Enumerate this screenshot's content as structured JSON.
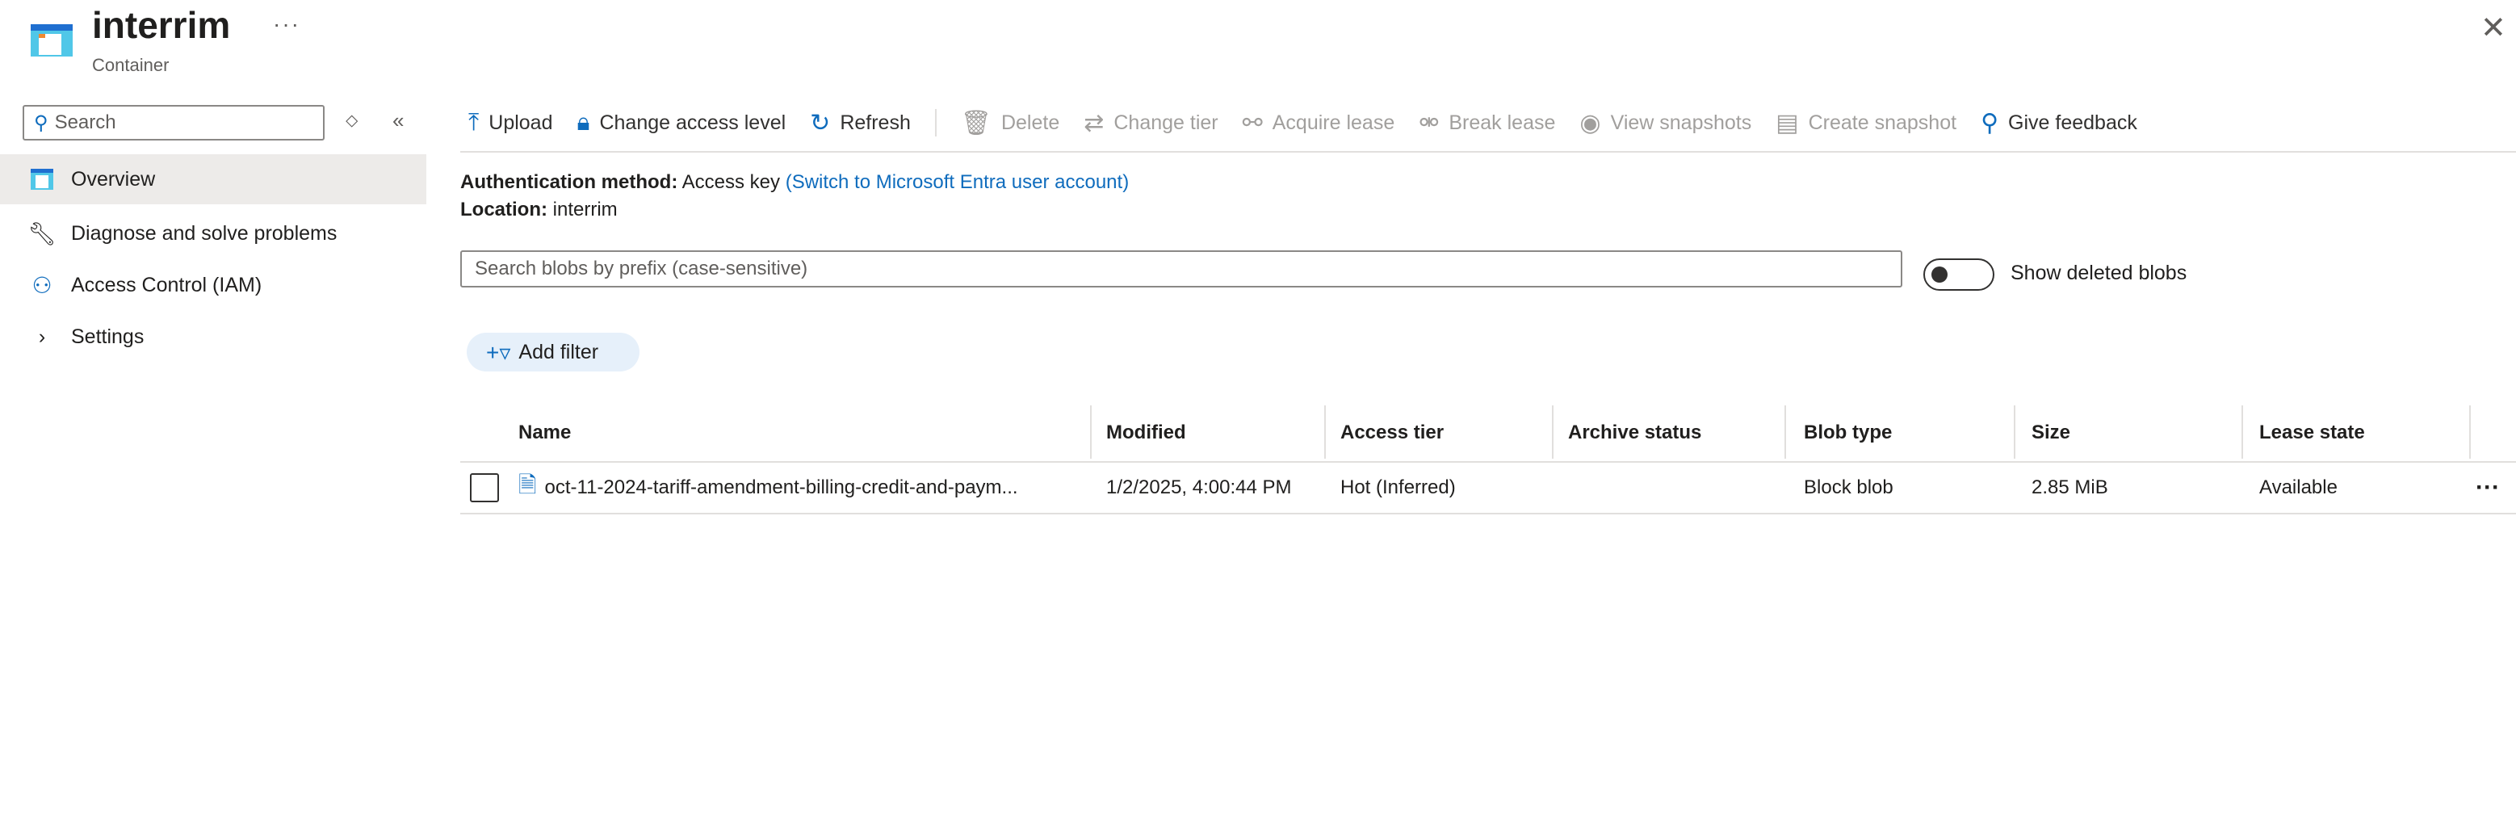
{
  "header": {
    "title": "interrim",
    "subtitle": "Container",
    "more": "···",
    "close": "✕"
  },
  "sidebar": {
    "search_placeholder": "Search",
    "items": [
      {
        "label": "Overview",
        "icon": "container-icon",
        "active": true
      },
      {
        "label": "Diagnose and solve problems",
        "icon": "wrench-icon"
      },
      {
        "label": "Access Control (IAM)",
        "icon": "people-icon"
      },
      {
        "label": "Settings",
        "icon": "chevron-right-icon"
      }
    ]
  },
  "toolbar": {
    "items": [
      {
        "label": "Upload",
        "icon": "upload-icon",
        "disabled": false
      },
      {
        "label": "Change access level",
        "icon": "lock-icon",
        "disabled": false
      },
      {
        "label": "Refresh",
        "icon": "refresh-icon",
        "disabled": false
      },
      {
        "label": "Delete",
        "icon": "trash-icon",
        "disabled": true
      },
      {
        "label": "Change tier",
        "icon": "swap-icon",
        "disabled": true
      },
      {
        "label": "Acquire lease",
        "icon": "link-icon",
        "disabled": true
      },
      {
        "label": "Break lease",
        "icon": "broken-link-icon",
        "disabled": true
      },
      {
        "label": "View snapshots",
        "icon": "eye-icon",
        "disabled": true
      },
      {
        "label": "Create snapshot",
        "icon": "snapshot-icon",
        "disabled": true
      },
      {
        "label": "Give feedback",
        "icon": "feedback-icon",
        "disabled": false
      }
    ]
  },
  "info": {
    "auth_label": "Authentication method:",
    "auth_value": "Access key",
    "auth_link": "(Switch to Microsoft Entra user account)",
    "location_label": "Location:",
    "location_value": "interrim"
  },
  "blob_search": {
    "placeholder": "Search blobs by prefix (case-sensitive)"
  },
  "show_deleted": {
    "label": "Show deleted blobs",
    "on": false
  },
  "add_filter": "Add filter",
  "table": {
    "columns": [
      "Name",
      "Modified",
      "Access tier",
      "Archive status",
      "Blob type",
      "Size",
      "Lease state"
    ],
    "rows": [
      {
        "name": "oct-11-2024-tariff-amendment-billing-credit-and-paym...",
        "modified": "1/2/2025, 4:00:44 PM",
        "access_tier": "Hot (Inferred)",
        "archive_status": "",
        "blob_type": "Block blob",
        "size": "2.85 MiB",
        "lease_state": "Available",
        "more": "···"
      }
    ]
  },
  "colors": {
    "accent": "#0f6cbd",
    "selected_bg": "#edebe9",
    "disabled": "#a19f9d"
  }
}
